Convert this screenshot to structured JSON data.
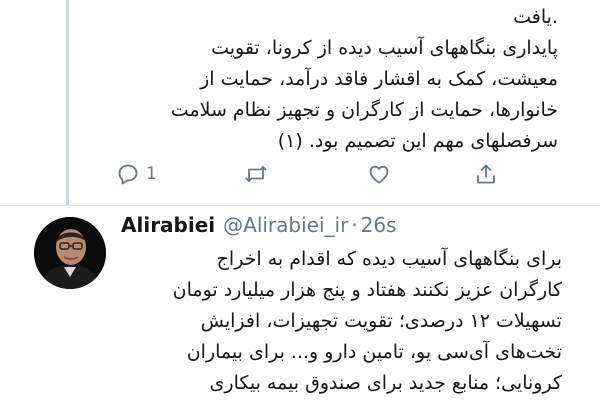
{
  "tweet1": {
    "lines": [
      ".یافت",
      "پایداری بنگاههای آسیب دیده از کرونا، تقویت",
      "معیشت، کمک به اقشار فاقد درآمد، حمایت از",
      "خانوارها، حمایت از کارگران و تجهیز نظام سلامت",
      "سرفصلهای مهم این تصمیم بود. (۱)"
    ],
    "actions": {
      "reply_count": "1",
      "reply_icon": "reply-icon",
      "retweet_icon": "retweet-icon",
      "like_icon": "heart-icon",
      "share_icon": "share-icon"
    }
  },
  "tweet2": {
    "display_name": "Alirabiei",
    "handle": "@Alirabiei_ir",
    "separator": "·",
    "time": "26s",
    "lines": [
      "برای بنگاههای آسیب دیده که اقدام به اخراج",
      "کارگران عزیز نکنند هفتاد و پنج هزار میلیارد تومان",
      "تسهیلات ۱۲ درصدی؛ تقویت تجهیزات، افزایش",
      "تخت‌های آی‌سی یو، تامین دارو و... برای بیماران",
      "کرونایی؛ منابع جدید برای صندوق بیمه بیکاری"
    ]
  },
  "colors": {
    "text": "#14171a",
    "secondary": "#657786",
    "thread_line": "#ccd6dd"
  }
}
